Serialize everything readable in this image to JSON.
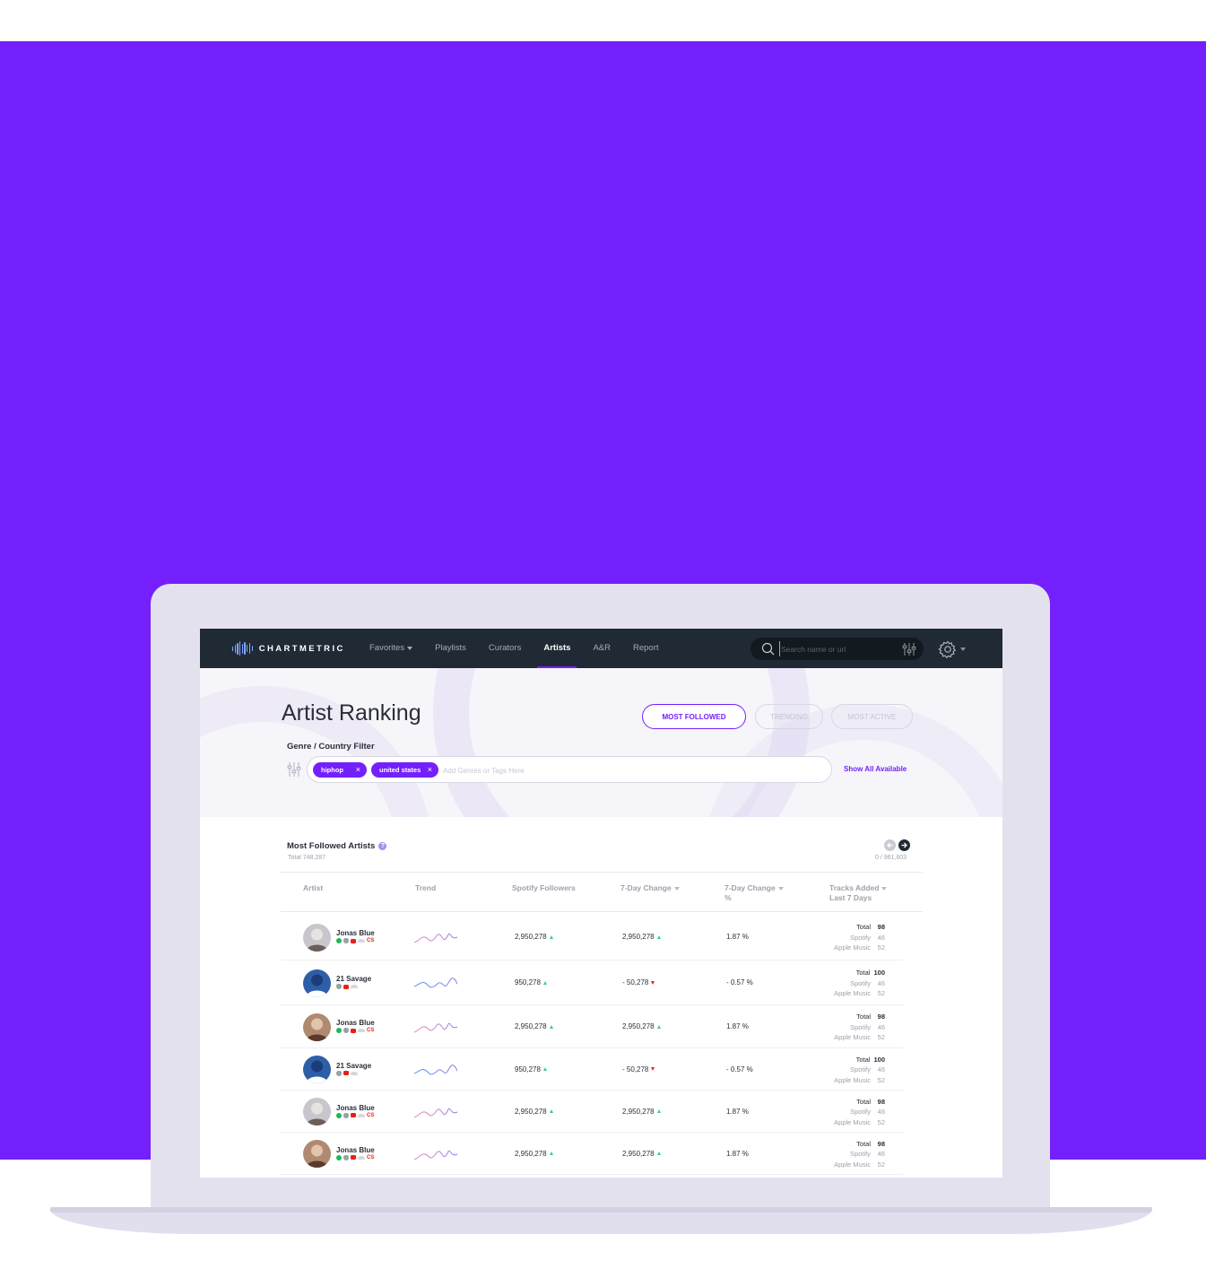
{
  "app": {
    "logo_text": "CHARTMETRIC",
    "brand_color": "#7420fd",
    "nav_bg": "#1f2a35"
  },
  "nav": {
    "items": [
      {
        "label": "Favorites",
        "has_caret": true,
        "active": false
      },
      {
        "label": "Playlists",
        "has_caret": false,
        "active": false
      },
      {
        "label": "Curators",
        "has_caret": false,
        "active": false
      },
      {
        "label": "Artists",
        "has_caret": false,
        "active": true
      },
      {
        "label": "A&R",
        "has_caret": false,
        "active": false
      },
      {
        "label": "Report",
        "has_caret": false,
        "active": false
      }
    ],
    "search_placeholder": "Search name or url"
  },
  "page": {
    "title": "Artist Ranking",
    "tabs": [
      {
        "label": "MOST FOLLOWED",
        "active": true
      },
      {
        "label": "TRENDING",
        "active": false
      },
      {
        "label": "MOST ACTIVE",
        "active": false
      }
    ],
    "filter": {
      "label": "Genre / Country Filter",
      "chips": [
        "hiphop",
        "united states"
      ],
      "input_placeholder": "Add Genres or Tags Here",
      "show_all": "Show All Available"
    }
  },
  "table": {
    "title": "Most Followed Artists",
    "help": "?",
    "total": "Total 748,287",
    "pager": "0 / 961,603",
    "columns": {
      "artist": "Artist",
      "trend": "Trend",
      "spotify_followers": "Spotify Followers",
      "change_7d": "7-Day Change",
      "change_7d_pct_line1": "7-Day Change",
      "change_7d_pct_line2": "%",
      "tracks_line1": "Tracks Added",
      "tracks_line2": "Last 7 Days"
    },
    "track_labels": {
      "total": "Total",
      "spotify": "Spotify",
      "apple": "Apple Music"
    },
    "rows": [
      {
        "name": "Jonas Blue",
        "platforms": [
          "spotify",
          "apple",
          "youtube",
          "soundcloud",
          "cs"
        ],
        "cs_text": "CS",
        "followers": "2,950,278",
        "followers_dir": "up",
        "change": "2,950,278",
        "change_dir": "up",
        "pct": "1.87 %",
        "total": "98",
        "spotify": "46",
        "apple": "52",
        "avatar": "a",
        "trend_color": "pink"
      },
      {
        "name": "21 Savage",
        "platforms": [
          "apple",
          "youtube",
          "soundcloud"
        ],
        "cs_text": "",
        "followers": "950,278",
        "followers_dir": "up",
        "change": "- 50,278",
        "change_dir": "down",
        "pct": "- 0.57 %",
        "total": "100",
        "spotify": "46",
        "apple": "52",
        "avatar": "b",
        "trend_color": "blue"
      },
      {
        "name": "Jonas Blue",
        "platforms": [
          "spotify",
          "apple",
          "youtube",
          "soundcloud",
          "cs"
        ],
        "cs_text": "CS",
        "followers": "2,950,278",
        "followers_dir": "up",
        "change": "2,950,278",
        "change_dir": "up",
        "pct": "1.87 %",
        "total": "98",
        "spotify": "46",
        "apple": "52",
        "avatar": "c",
        "trend_color": "pink"
      },
      {
        "name": "21 Savage",
        "platforms": [
          "apple",
          "youtube",
          "soundcloud"
        ],
        "cs_text": "",
        "followers": "950,278",
        "followers_dir": "up",
        "change": "- 50,278",
        "change_dir": "down",
        "pct": "- 0.57 %",
        "total": "100",
        "spotify": "46",
        "apple": "52",
        "avatar": "b",
        "trend_color": "blue"
      },
      {
        "name": "Jonas Blue",
        "platforms": [
          "spotify",
          "apple",
          "youtube",
          "soundcloud",
          "cs"
        ],
        "cs_text": "CS",
        "followers": "2,950,278",
        "followers_dir": "up",
        "change": "2,950,278",
        "change_dir": "up",
        "pct": "1.87 %",
        "total": "98",
        "spotify": "46",
        "apple": "52",
        "avatar": "a",
        "trend_color": "pink"
      },
      {
        "name": "Jonas Blue",
        "platforms": [
          "spotify",
          "apple",
          "youtube",
          "soundcloud",
          "cs"
        ],
        "cs_text": "CS",
        "followers": "2,950,278",
        "followers_dir": "up",
        "change": "2,950,278",
        "change_dir": "up",
        "pct": "1.87 %",
        "total": "98",
        "spotify": "46",
        "apple": "52",
        "avatar": "c",
        "trend_color": "pink"
      }
    ]
  }
}
